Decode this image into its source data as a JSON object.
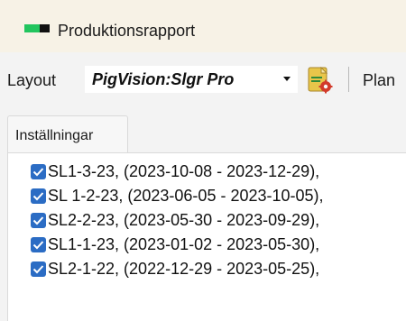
{
  "window": {
    "title": "Produktionsrapport",
    "icon": "green-black-bar-icon"
  },
  "toolbar": {
    "layout_label": "Layout",
    "layout_value": "PigVision:Slgr Pro",
    "report_icon": "report-settings-icon",
    "plan_label": "Plan"
  },
  "tabs": [
    {
      "label": "Inställningar"
    }
  ],
  "selection_list": {
    "items": [
      {
        "label": "SL1-3-23, (2023-10-08 - 2023-12-29),",
        "checked": true
      },
      {
        "label": "SL 1-2-23, (2023-06-05 - 2023-10-05),",
        "checked": true
      },
      {
        "label": "SL2-2-23, (2023-05-30 - 2023-09-29),",
        "checked": true
      },
      {
        "label": "SL1-1-23, (2023-01-02 - 2023-05-30),",
        "checked": true
      },
      {
        "label": "SL2-1-22, (2022-12-29 - 2023-05-25),",
        "checked": true
      }
    ]
  },
  "colors": {
    "checkbox": "#2b6cc4",
    "titlebar": "#f7f2e6",
    "icon_green": "#22c55e"
  }
}
